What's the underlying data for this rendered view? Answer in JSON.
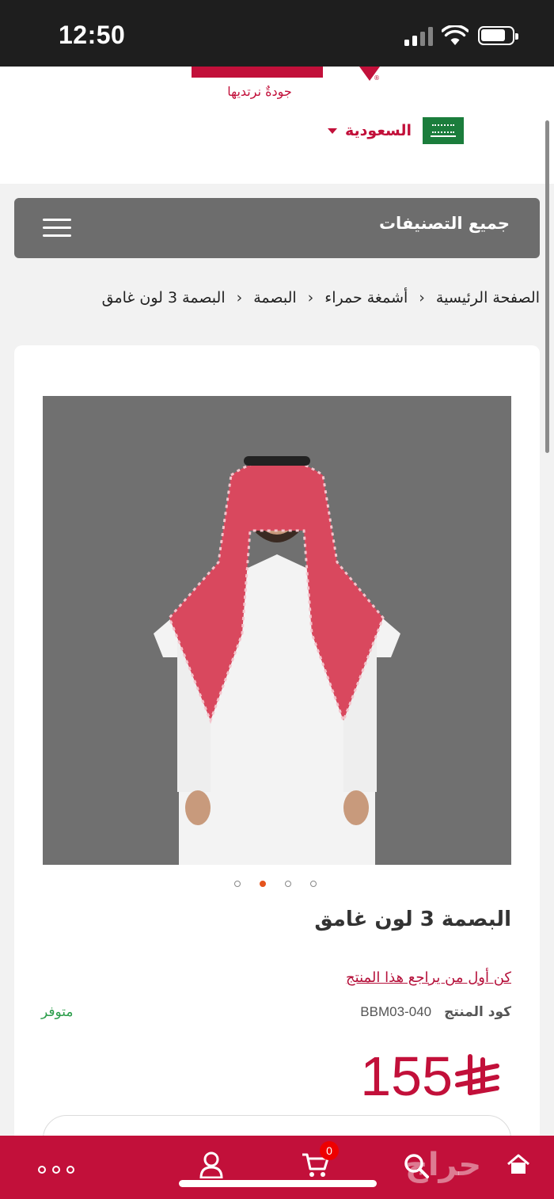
{
  "status_bar": {
    "time": "12:50"
  },
  "header": {
    "tagline": "جودةٌ نرتديها",
    "country": "السعودية",
    "logo_icon": "brand-logo",
    "flag_icon": "saudi-flag-icon"
  },
  "categories": {
    "label": "جميع التصنيفات",
    "menu_icon": "hamburger-icon"
  },
  "breadcrumb": {
    "items": [
      "الصفحة الرئيسية",
      "أشمغة حمراء",
      "البصمة",
      "البصمة 3 لون غامق"
    ]
  },
  "product": {
    "title": "البصمة 3 لون غامق",
    "review_link": "كن أول من يراجع هذا المنتج",
    "sku_label": "كود المنتج",
    "sku_value": "BBM03-040",
    "stock": "متوفر",
    "price": "155",
    "currency_icon": "saudi-riyal-icon",
    "carousel": {
      "count": 4,
      "active_index": 2
    },
    "image_description_icon": "product-photo"
  },
  "bottom_nav": {
    "cart_count": "0",
    "brand_watermark": "حراج",
    "items": [
      "more-icon",
      "account-icon",
      "cart-icon",
      "search-icon",
      "home-icon"
    ]
  },
  "colors": {
    "brand": "#c2103a",
    "status_bar": "#1e1e1e",
    "categories_bar": "#6d6d6d",
    "stock_green": "#2a9d4a",
    "carousel_active": "#e5541d"
  }
}
